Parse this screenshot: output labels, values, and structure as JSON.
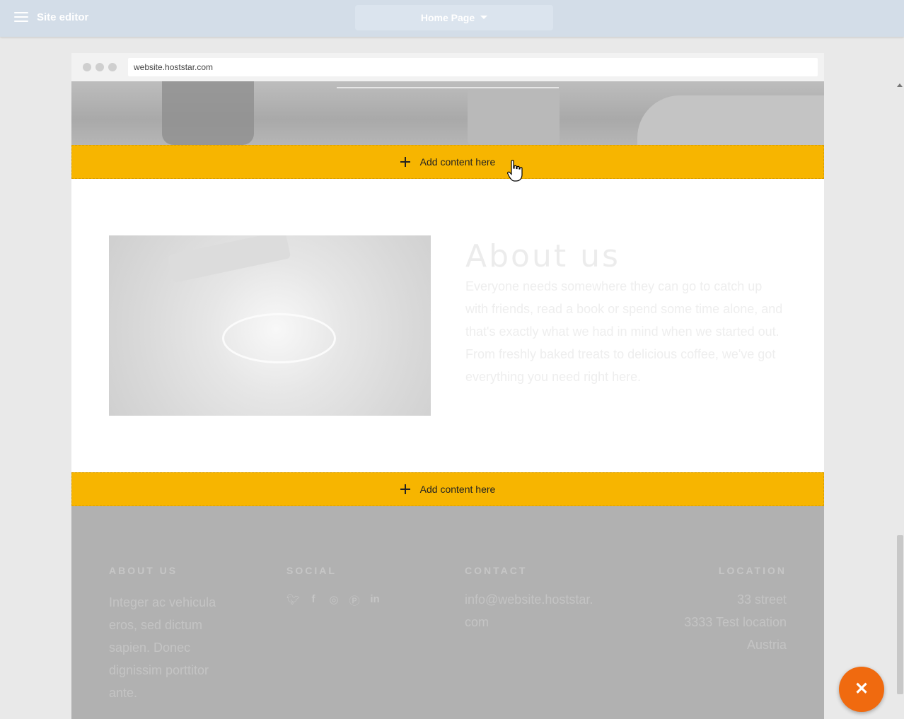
{
  "editor": {
    "title": "Site editor",
    "page_select": "Home Page"
  },
  "browser": {
    "url": "website.hoststar.com"
  },
  "add_bars": [
    {
      "label": "Add content here"
    },
    {
      "label": "Add content here"
    }
  ],
  "about": {
    "title": "About us",
    "text": "Everyone needs somewhere they can go to catch up with friends, read a book or spend some time alone, and that's exactly what we had in mind when we started out. From freshly baked treats to delicious coffee, we've got everything you need right here."
  },
  "footer": {
    "about": {
      "heading": "ABOUT US",
      "lines": [
        "Integer ac vehicula",
        "eros, sed dictum",
        "sapien. Donec",
        "dignissim porttitor",
        "ante."
      ]
    },
    "social": {
      "heading": "SOCIAL",
      "icons": [
        "twitter-icon",
        "facebook-icon",
        "instagram-icon",
        "pinterest-icon",
        "linkedin-icon"
      ]
    },
    "contact": {
      "heading": "CONTACT",
      "lines": [
        "info@website.hoststar.",
        "com"
      ]
    },
    "location": {
      "heading": "LOCATION",
      "lines": [
        "33 street",
        "3333 Test location",
        "Austria"
      ]
    }
  },
  "fab": {
    "icon": "close-icon"
  }
}
